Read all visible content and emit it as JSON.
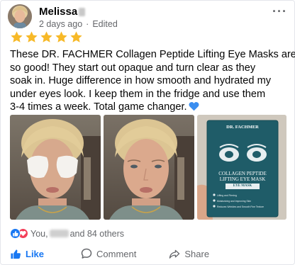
{
  "post": {
    "author_name": "Melissa",
    "time": "2 days ago",
    "separator": "·",
    "edited": "Edited",
    "more_label": "···"
  },
  "rating": {
    "stars": 5,
    "max": 5,
    "color": "#f7b928"
  },
  "review": {
    "lines": [
      "These DR. FACHMER Collagen Peptide Lifting Eye Masks are",
      "so good! They start out opaque and turn clear as they",
      "soak in. Huge difference in how smooth and hydrated my",
      "under eyes look. I keep them in the fridge and use them",
      "3-4 times a week. Total game changer."
    ],
    "emoji": "blue-heart"
  },
  "product_box": {
    "brand": "DR. FACHMER",
    "title_line1": "COLLAGEN PEPTIDE",
    "title_line2": "LIFTING EYE MASK",
    "subtitle": "EYE MASK",
    "features": [
      "Lifting and Firming",
      "Moisturizing and Improving Skin",
      "Reduces Wrinkles and Smooth Fine Texture"
    ],
    "color": "#1f5c68"
  },
  "reactions": {
    "prefix": "You,",
    "suffix": "and 84 others",
    "like_color": "#1877f2",
    "love_color": "#f33e58"
  },
  "actions": {
    "like_label": "Like",
    "comment_label": "Comment",
    "share_label": "Share"
  }
}
